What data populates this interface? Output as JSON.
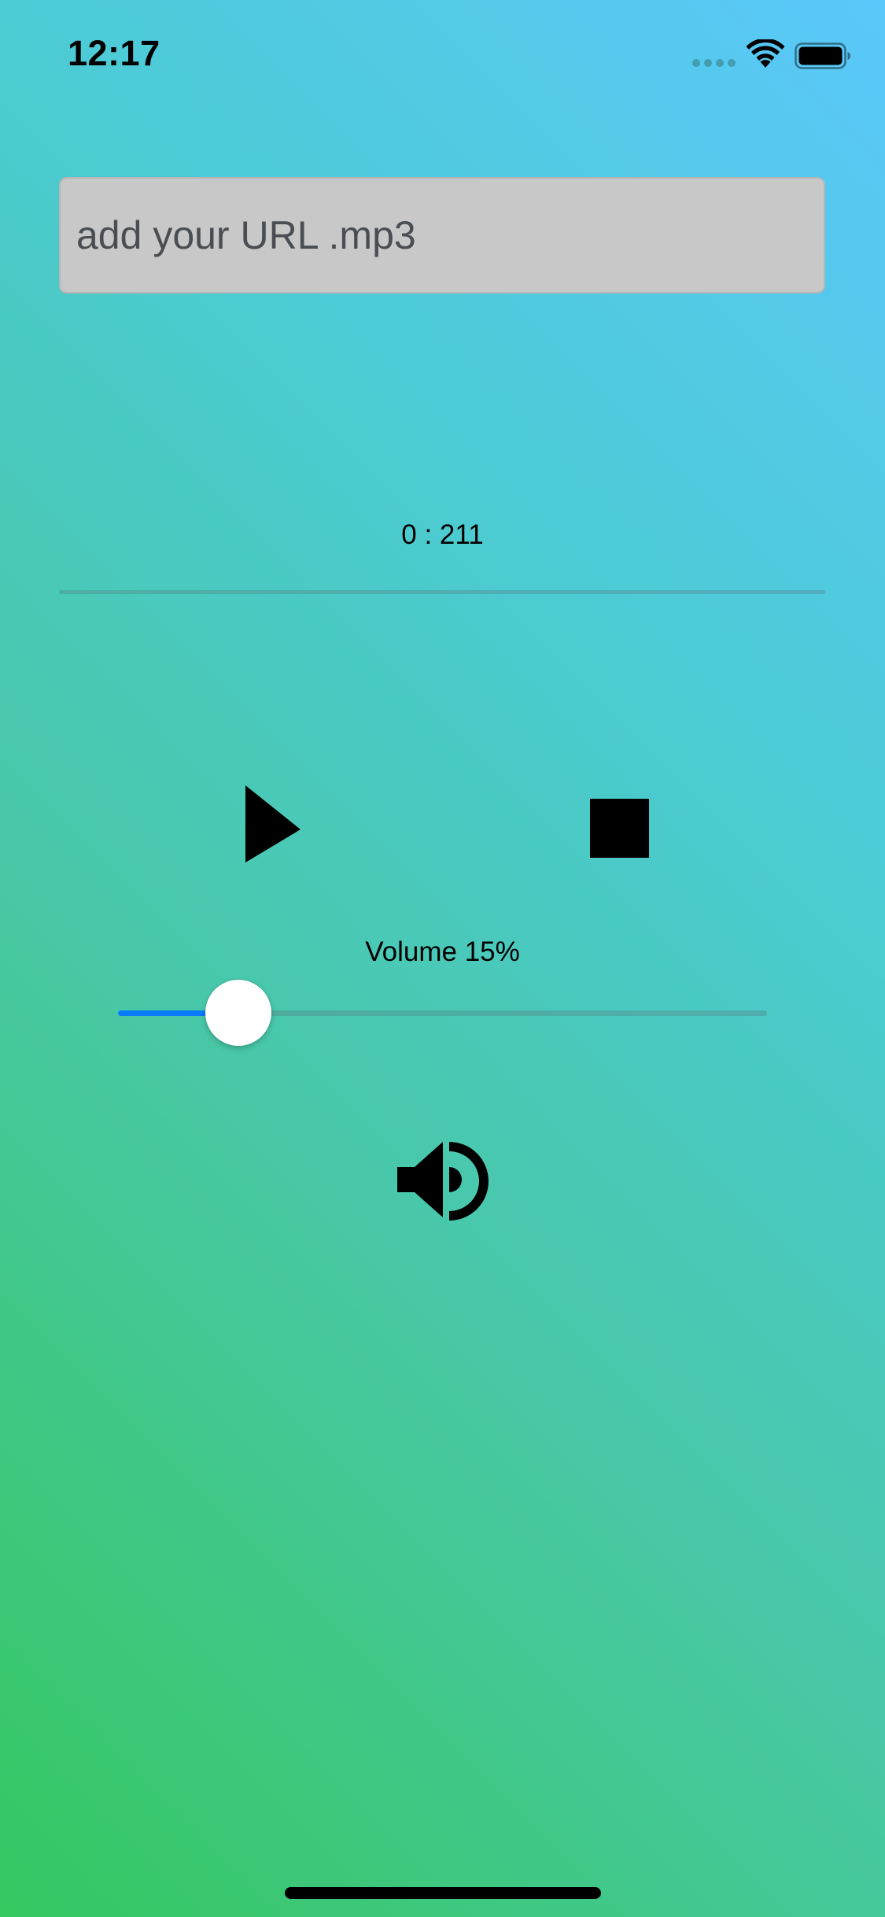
{
  "status_bar": {
    "time": "12:17"
  },
  "url_input": {
    "placeholder": "add your URL .mp3",
    "value": ""
  },
  "player": {
    "time_display": "0 : 211",
    "progress_fraction": 0
  },
  "controls": {
    "play_icon": "play-icon",
    "stop_icon": "stop-icon"
  },
  "volume": {
    "label": "Volume 15%",
    "level_fraction": 0.15,
    "speaker_icon": "speaker-volume-icon"
  },
  "colors": {
    "accent": "#0a7aff",
    "gradient_top": "#5ac8fa",
    "gradient_bottom": "#36c760",
    "input_background": "#c8c8c8"
  }
}
